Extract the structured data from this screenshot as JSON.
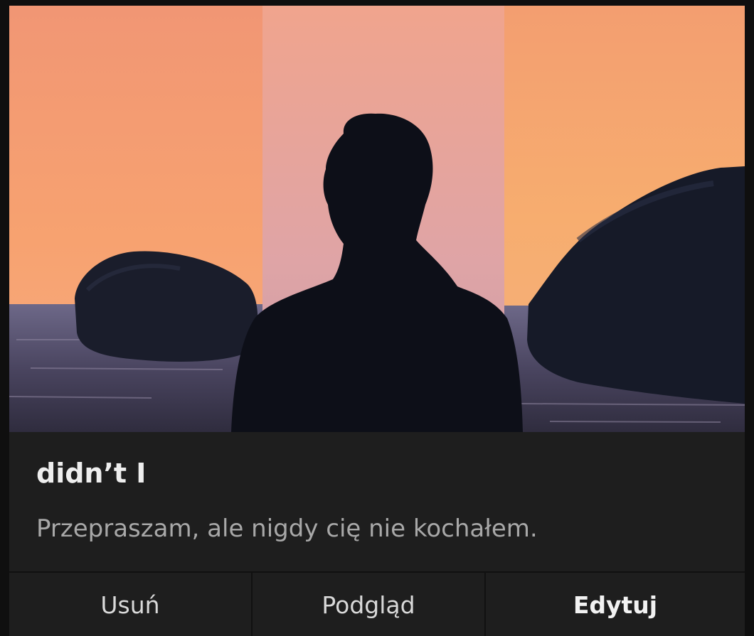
{
  "story": {
    "cover_image": "silhouette-sunset-cover",
    "title": "didn’t I",
    "description": "Przepraszam, ale nigdy cię nie kochałem."
  },
  "actions": {
    "delete_label": "Usuń",
    "preview_label": "Podgląd",
    "edit_label": "Edytuj"
  },
  "colors": {
    "card_background": "#1e1e1e",
    "page_background": "#0f0f0f",
    "title_text": "#eeeeee",
    "description_text": "#a8a8a8",
    "sky_orange": "#f5a66e",
    "sky_pink": "#e4a49f"
  }
}
